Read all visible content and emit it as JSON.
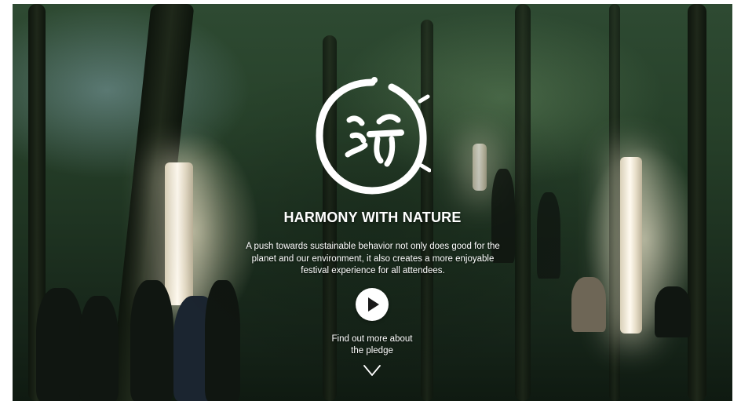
{
  "hero": {
    "title": "HARMONY WITH NATURE",
    "description_line1": "A push towards sustainable behavior not only does good for the",
    "description_line2": "planet and our environment, it also creates a more enjoyable",
    "description_line3": "festival experience for all attendees.",
    "cta_line1": "Find out more about",
    "cta_line2": "the pledge",
    "icons": {
      "logo": "harmony-leaf-face-logo",
      "play": "play-icon",
      "scroll": "chevron-down-icon"
    },
    "colors": {
      "text": "#ffffff",
      "button_bg": "#ffffff",
      "button_icon": "#1a1a1a"
    }
  }
}
